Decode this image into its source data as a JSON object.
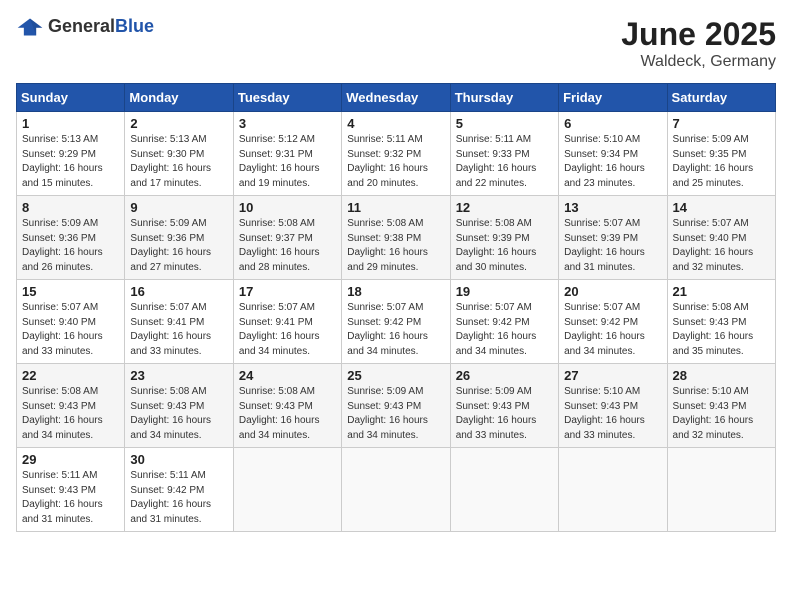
{
  "logo": {
    "text_general": "General",
    "text_blue": "Blue"
  },
  "header": {
    "month_year": "June 2025",
    "location": "Waldeck, Germany"
  },
  "weekdays": [
    "Sunday",
    "Monday",
    "Tuesday",
    "Wednesday",
    "Thursday",
    "Friday",
    "Saturday"
  ],
  "weeks": [
    [
      {
        "day": 1,
        "info": "Sunrise: 5:13 AM\nSunset: 9:29 PM\nDaylight: 16 hours\nand 15 minutes."
      },
      {
        "day": 2,
        "info": "Sunrise: 5:13 AM\nSunset: 9:30 PM\nDaylight: 16 hours\nand 17 minutes."
      },
      {
        "day": 3,
        "info": "Sunrise: 5:12 AM\nSunset: 9:31 PM\nDaylight: 16 hours\nand 19 minutes."
      },
      {
        "day": 4,
        "info": "Sunrise: 5:11 AM\nSunset: 9:32 PM\nDaylight: 16 hours\nand 20 minutes."
      },
      {
        "day": 5,
        "info": "Sunrise: 5:11 AM\nSunset: 9:33 PM\nDaylight: 16 hours\nand 22 minutes."
      },
      {
        "day": 6,
        "info": "Sunrise: 5:10 AM\nSunset: 9:34 PM\nDaylight: 16 hours\nand 23 minutes."
      },
      {
        "day": 7,
        "info": "Sunrise: 5:09 AM\nSunset: 9:35 PM\nDaylight: 16 hours\nand 25 minutes."
      }
    ],
    [
      {
        "day": 8,
        "info": "Sunrise: 5:09 AM\nSunset: 9:36 PM\nDaylight: 16 hours\nand 26 minutes."
      },
      {
        "day": 9,
        "info": "Sunrise: 5:09 AM\nSunset: 9:36 PM\nDaylight: 16 hours\nand 27 minutes."
      },
      {
        "day": 10,
        "info": "Sunrise: 5:08 AM\nSunset: 9:37 PM\nDaylight: 16 hours\nand 28 minutes."
      },
      {
        "day": 11,
        "info": "Sunrise: 5:08 AM\nSunset: 9:38 PM\nDaylight: 16 hours\nand 29 minutes."
      },
      {
        "day": 12,
        "info": "Sunrise: 5:08 AM\nSunset: 9:39 PM\nDaylight: 16 hours\nand 30 minutes."
      },
      {
        "day": 13,
        "info": "Sunrise: 5:07 AM\nSunset: 9:39 PM\nDaylight: 16 hours\nand 31 minutes."
      },
      {
        "day": 14,
        "info": "Sunrise: 5:07 AM\nSunset: 9:40 PM\nDaylight: 16 hours\nand 32 minutes."
      }
    ],
    [
      {
        "day": 15,
        "info": "Sunrise: 5:07 AM\nSunset: 9:40 PM\nDaylight: 16 hours\nand 33 minutes."
      },
      {
        "day": 16,
        "info": "Sunrise: 5:07 AM\nSunset: 9:41 PM\nDaylight: 16 hours\nand 33 minutes."
      },
      {
        "day": 17,
        "info": "Sunrise: 5:07 AM\nSunset: 9:41 PM\nDaylight: 16 hours\nand 34 minutes."
      },
      {
        "day": 18,
        "info": "Sunrise: 5:07 AM\nSunset: 9:42 PM\nDaylight: 16 hours\nand 34 minutes."
      },
      {
        "day": 19,
        "info": "Sunrise: 5:07 AM\nSunset: 9:42 PM\nDaylight: 16 hours\nand 34 minutes."
      },
      {
        "day": 20,
        "info": "Sunrise: 5:07 AM\nSunset: 9:42 PM\nDaylight: 16 hours\nand 34 minutes."
      },
      {
        "day": 21,
        "info": "Sunrise: 5:08 AM\nSunset: 9:43 PM\nDaylight: 16 hours\nand 35 minutes."
      }
    ],
    [
      {
        "day": 22,
        "info": "Sunrise: 5:08 AM\nSunset: 9:43 PM\nDaylight: 16 hours\nand 34 minutes."
      },
      {
        "day": 23,
        "info": "Sunrise: 5:08 AM\nSunset: 9:43 PM\nDaylight: 16 hours\nand 34 minutes."
      },
      {
        "day": 24,
        "info": "Sunrise: 5:08 AM\nSunset: 9:43 PM\nDaylight: 16 hours\nand 34 minutes."
      },
      {
        "day": 25,
        "info": "Sunrise: 5:09 AM\nSunset: 9:43 PM\nDaylight: 16 hours\nand 34 minutes."
      },
      {
        "day": 26,
        "info": "Sunrise: 5:09 AM\nSunset: 9:43 PM\nDaylight: 16 hours\nand 33 minutes."
      },
      {
        "day": 27,
        "info": "Sunrise: 5:10 AM\nSunset: 9:43 PM\nDaylight: 16 hours\nand 33 minutes."
      },
      {
        "day": 28,
        "info": "Sunrise: 5:10 AM\nSunset: 9:43 PM\nDaylight: 16 hours\nand 32 minutes."
      }
    ],
    [
      {
        "day": 29,
        "info": "Sunrise: 5:11 AM\nSunset: 9:43 PM\nDaylight: 16 hours\nand 31 minutes."
      },
      {
        "day": 30,
        "info": "Sunrise: 5:11 AM\nSunset: 9:42 PM\nDaylight: 16 hours\nand 31 minutes."
      },
      null,
      null,
      null,
      null,
      null
    ]
  ]
}
